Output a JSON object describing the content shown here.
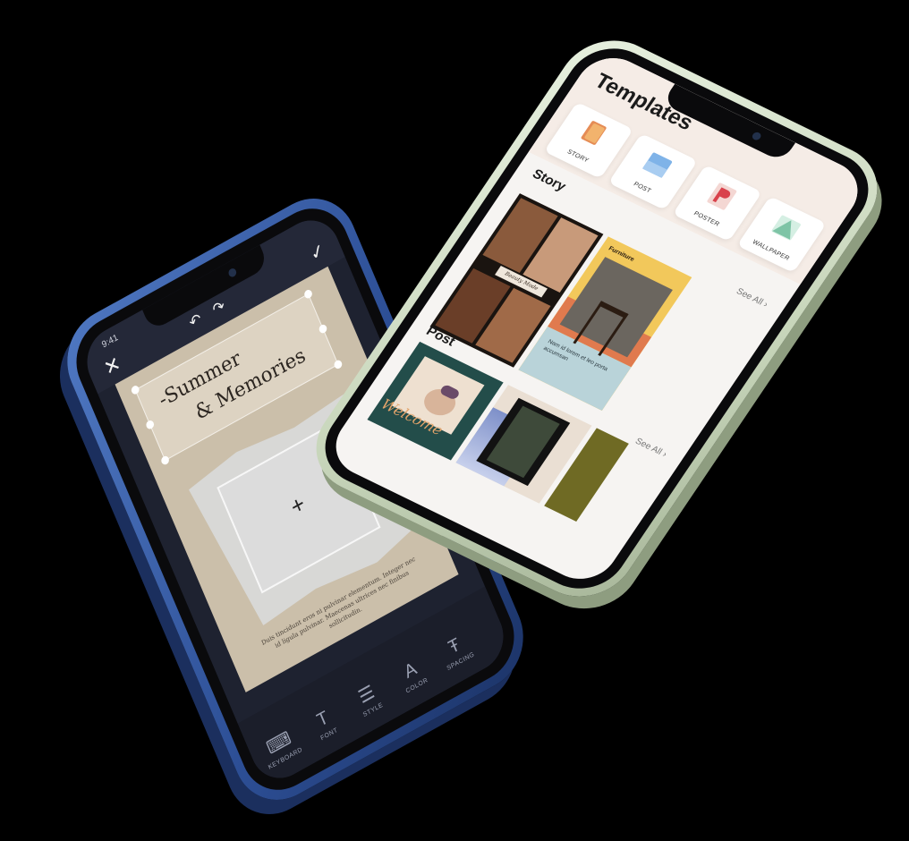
{
  "editor": {
    "time": "9:41",
    "close_icon": "✕",
    "undo_icon": "↶",
    "redo_icon": "↷",
    "check_icon": "✓",
    "title_line1": "-Summer",
    "title_line2": "& Memories",
    "add_photo": "+",
    "body_text": "Duis tincidunt eros ni pulvinar elementum. Integer nec id ligula pulvinar. Maecenas ultrices nec finibus sollicitudin.",
    "toolbar": [
      {
        "icon": "keyboard-icon",
        "glyph": "⌨",
        "label": "KEYBOARD"
      },
      {
        "icon": "font-icon",
        "glyph": "T",
        "label": "FONT"
      },
      {
        "icon": "style-icon",
        "glyph": "☰",
        "label": "STYLE"
      },
      {
        "icon": "color-icon",
        "glyph": "A",
        "label": "COLOR"
      },
      {
        "icon": "spacing-icon",
        "glyph": "Ŧ",
        "label": "SPACING"
      }
    ]
  },
  "templates": {
    "title": "Templates",
    "categories": [
      {
        "label": "STORY",
        "icon": "story-icon",
        "color": "#e58c55"
      },
      {
        "label": "POST",
        "icon": "post-icon",
        "color": "#7fb3e8"
      },
      {
        "label": "POSTER",
        "icon": "poster-icon",
        "color": "#d9424c"
      },
      {
        "label": "WALLPAPER",
        "icon": "wallpaper-icon",
        "color": "#7ec4a6"
      }
    ],
    "story_section": {
      "title": "Story",
      "see_all": "See All ›"
    },
    "story_cards": [
      {
        "label": "Beauty Mode"
      },
      {
        "heading": "Furniture",
        "text": "Nam id lorem et leo porta accumsan"
      }
    ],
    "post_section": {
      "title": "Post",
      "see_all": "See All ›"
    },
    "post_cards": [
      {
        "script": "Welcome"
      }
    ]
  }
}
